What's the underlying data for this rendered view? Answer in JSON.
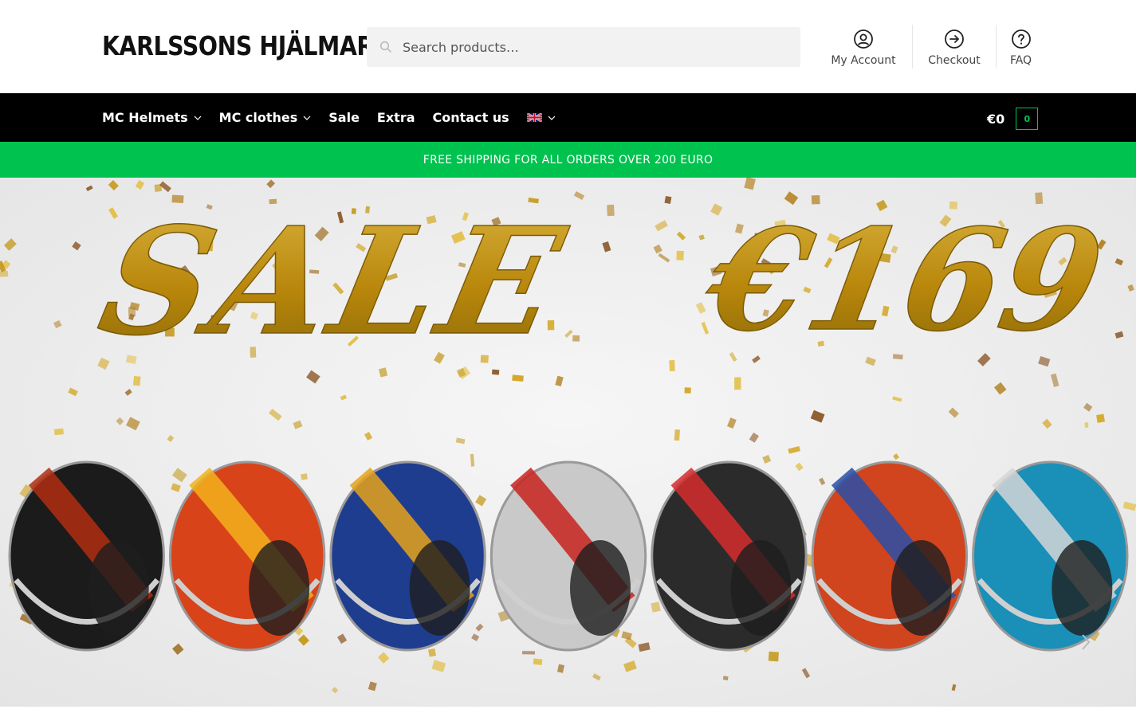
{
  "header": {
    "logo": "KARLSSONS HJÄLMAR",
    "search": {
      "placeholder": "Search products…"
    },
    "links": [
      {
        "label": "My Account",
        "icon": "user-circle-icon"
      },
      {
        "label": "Checkout",
        "icon": "arrow-circle-right-icon"
      },
      {
        "label": "FAQ",
        "icon": "question-circle-icon"
      }
    ]
  },
  "nav": {
    "items": [
      {
        "label": "MC Helmets",
        "has_dropdown": true
      },
      {
        "label": "MC clothes",
        "has_dropdown": true
      },
      {
        "label": "Sale",
        "has_dropdown": false
      },
      {
        "label": "Extra",
        "has_dropdown": false
      },
      {
        "label": "Contact us",
        "has_dropdown": false
      }
    ],
    "language_icon": "uk-flag-icon",
    "cart": {
      "total": "€0",
      "count": "0"
    }
  },
  "banner": {
    "text": "FREE SHIPPING FOR ALL ORDERS OVER 200 EURO"
  },
  "hero": {
    "headline": "SALE",
    "price": "€169",
    "helmet_count": 7
  },
  "colors": {
    "accent_green": "#00c24f",
    "nav_bg": "#000000",
    "gold": "#b8860b"
  }
}
